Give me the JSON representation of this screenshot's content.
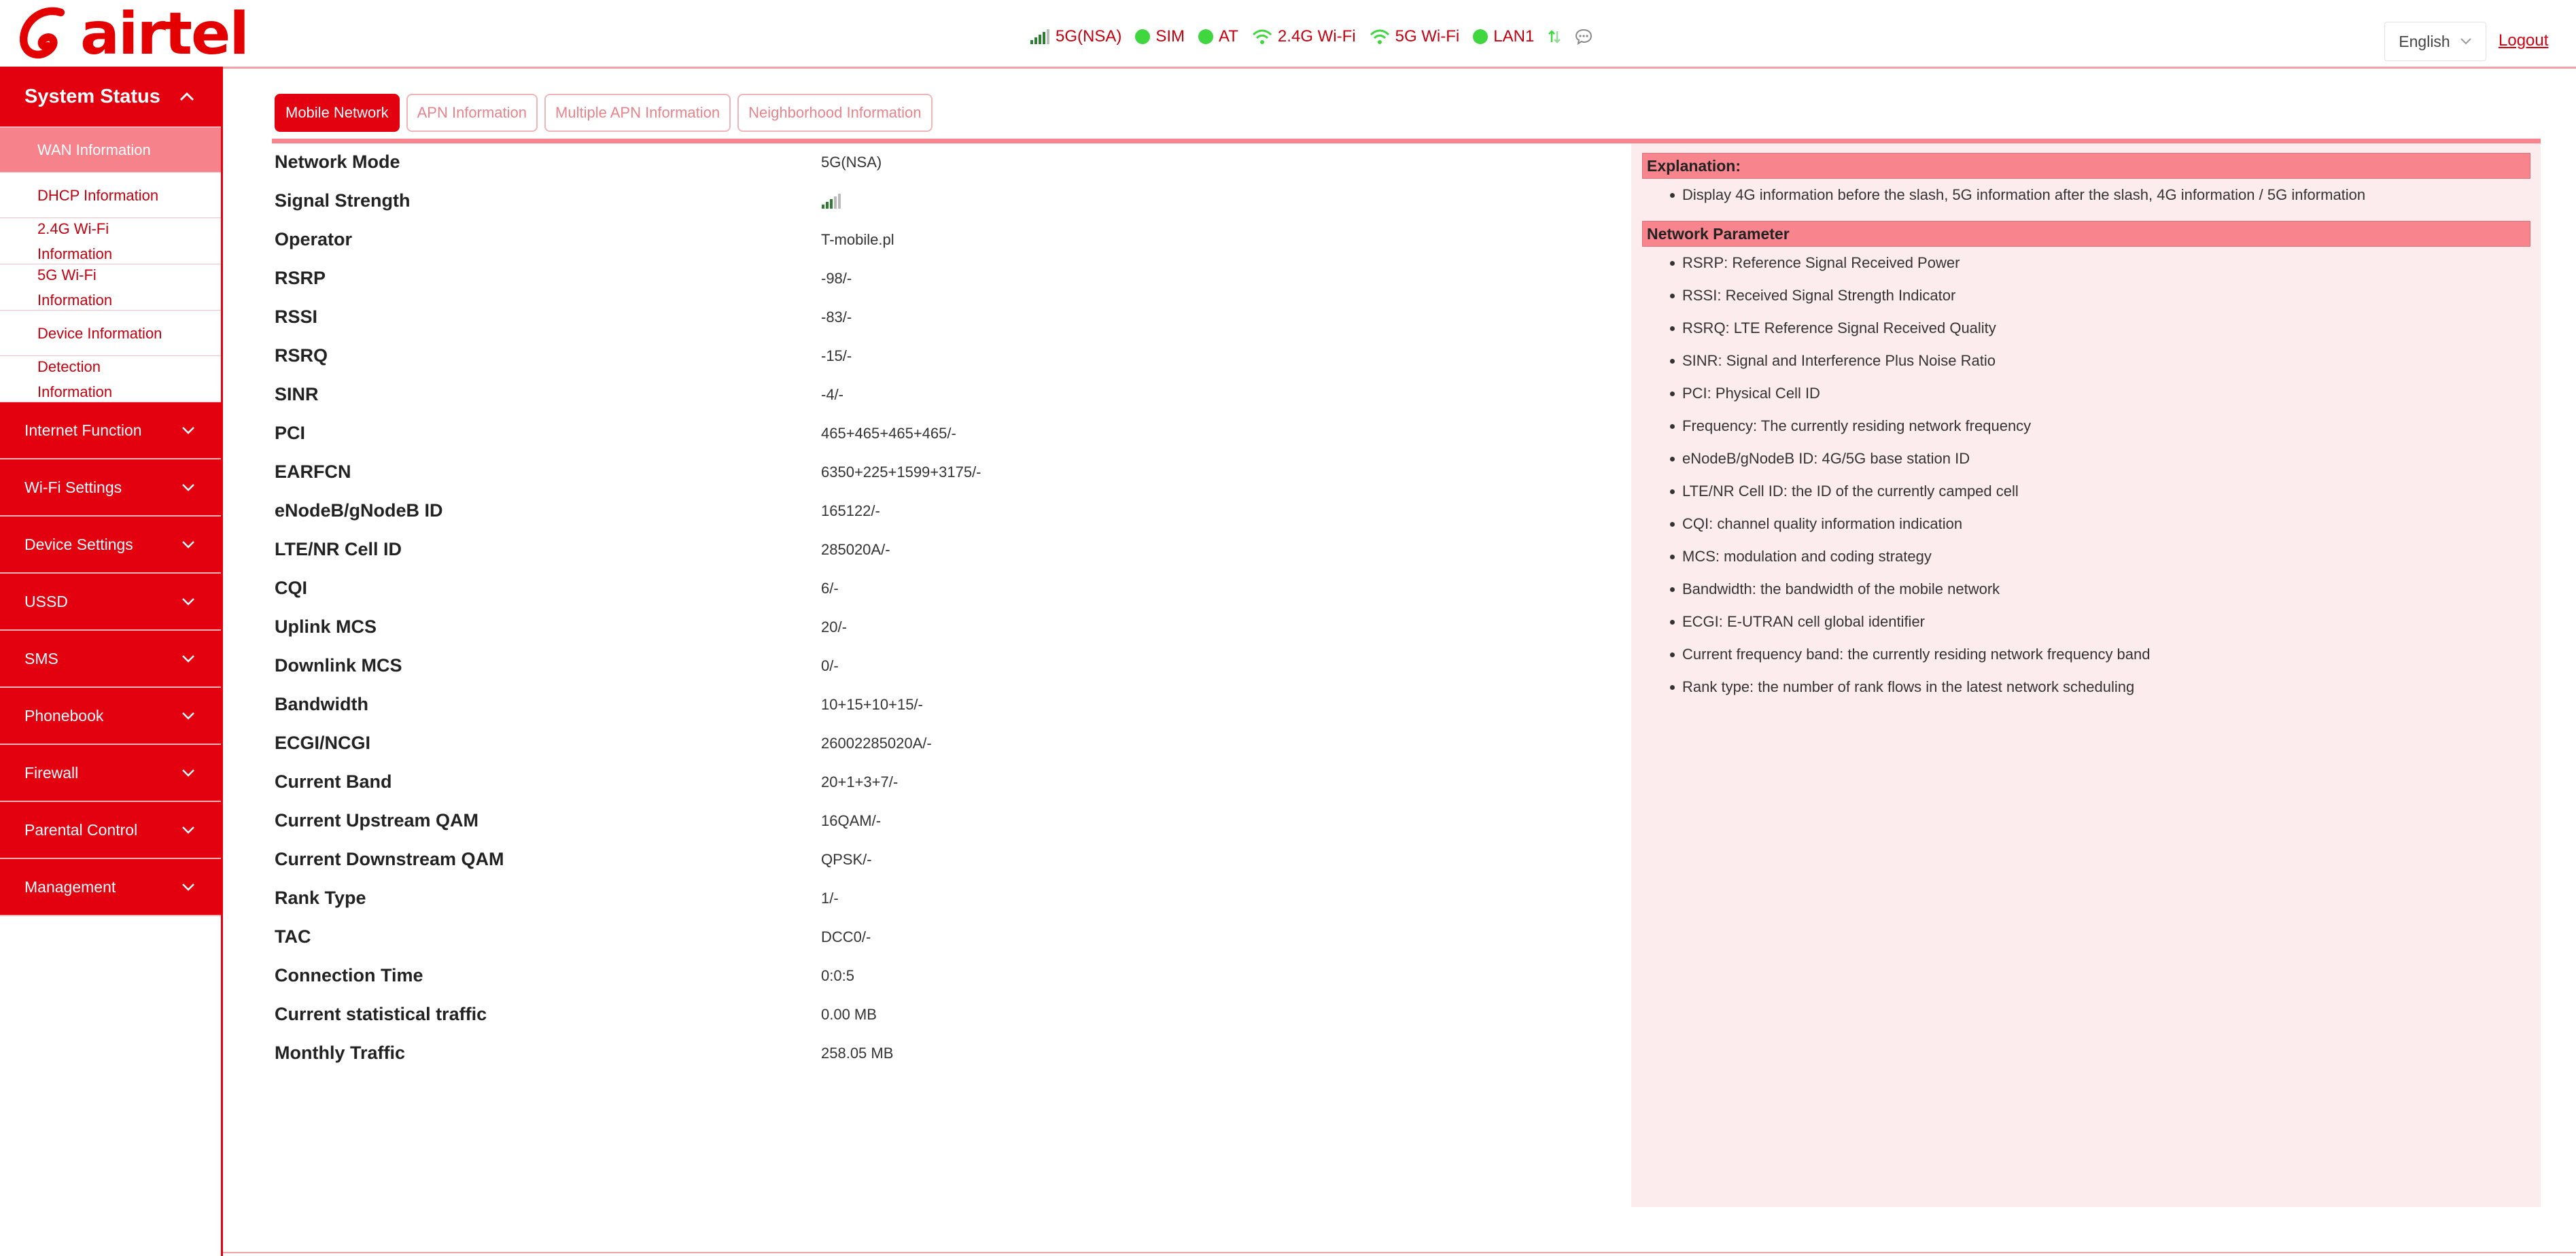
{
  "brand": {
    "logo_text": "airtel"
  },
  "status_bar": {
    "network": "5G(NSA)",
    "sim": "SIM",
    "at": "AT",
    "wifi24": "2.4G Wi-Fi",
    "wifi5": "5G Wi-Fi",
    "lan": "LAN1",
    "signal_bars": 4,
    "signal_bars_max": 5,
    "dot_color": "#3fd63f",
    "accent_color": "#e3000f"
  },
  "header": {
    "language": "English",
    "logout": "Logout"
  },
  "sidebar": {
    "system_status": "System Status",
    "sub_items": [
      "WAN Information",
      "DHCP Information",
      "2.4G Wi-Fi Information",
      "5G Wi-Fi Information",
      "Device Information",
      "Detection Information"
    ],
    "sections": [
      "Internet Function",
      "Wi-Fi Settings",
      "Device Settings",
      "USSD",
      "SMS",
      "Phonebook",
      "Firewall",
      "Parental Control",
      "Management"
    ]
  },
  "tabs": [
    "Mobile Network",
    "APN Information",
    "Multiple APN Information",
    "Neighborhood Information"
  ],
  "info_rows": [
    {
      "label": "Network Mode",
      "value": "5G(NSA)"
    },
    {
      "label": "Signal Strength",
      "value": ""
    },
    {
      "label": "Operator",
      "value": "T-mobile.pl"
    },
    {
      "label": "RSRP",
      "value": "-98/-"
    },
    {
      "label": "RSSI",
      "value": "-83/-"
    },
    {
      "label": "RSRQ",
      "value": "-15/-"
    },
    {
      "label": "SINR",
      "value": "-4/-"
    },
    {
      "label": "PCI",
      "value": "465+465+465+465/-"
    },
    {
      "label": "EARFCN",
      "value": "6350+225+1599+3175/-"
    },
    {
      "label": "eNodeB/gNodeB ID",
      "value": "165122/-"
    },
    {
      "label": "LTE/NR Cell ID",
      "value": "285020A/-"
    },
    {
      "label": "CQI",
      "value": "6/-"
    },
    {
      "label": "Uplink MCS",
      "value": "20/-"
    },
    {
      "label": "Downlink MCS",
      "value": "0/-"
    },
    {
      "label": "Bandwidth",
      "value": "10+15+10+15/-"
    },
    {
      "label": "ECGI/NCGI",
      "value": "26002285020A/-"
    },
    {
      "label": "Current Band",
      "value": "20+1+3+7/-"
    },
    {
      "label": "Current Upstream QAM",
      "value": "16QAM/-"
    },
    {
      "label": "Current Downstream QAM",
      "value": "QPSK/-"
    },
    {
      "label": "Rank Type",
      "value": "1/-"
    },
    {
      "label": "TAC",
      "value": "DCC0/-"
    },
    {
      "label": "Connection Time",
      "value": "0:0:5"
    },
    {
      "label": "Current statistical traffic",
      "value": "0.00 MB"
    },
    {
      "label": "Monthly Traffic",
      "value": "258.05 MB"
    }
  ],
  "explanation": {
    "title": "Explanation:",
    "items": [
      "Display 4G information before the slash, 5G information after the slash, 4G information / 5G information"
    ],
    "param_title": "Network Parameter",
    "params": [
      "RSRP: Reference Signal Received Power",
      "RSSI: Received Signal Strength Indicator",
      "RSRQ: LTE Reference Signal Received Quality",
      "SINR: Signal and Interference Plus Noise Ratio",
      "PCI: Physical Cell ID",
      "Frequency: The currently residing network frequency",
      "eNodeB/gNodeB ID: 4G/5G base station ID",
      "LTE/NR Cell ID: the ID of the currently camped cell",
      "CQI: channel quality information indication",
      "MCS: modulation and coding strategy",
      "Bandwidth: the bandwidth of the mobile network",
      "ECGI: E-UTRAN cell global identifier",
      "Current frequency band: the currently residing network frequency band",
      "Rank type: the number of rank flows in the latest network scheduling"
    ]
  }
}
